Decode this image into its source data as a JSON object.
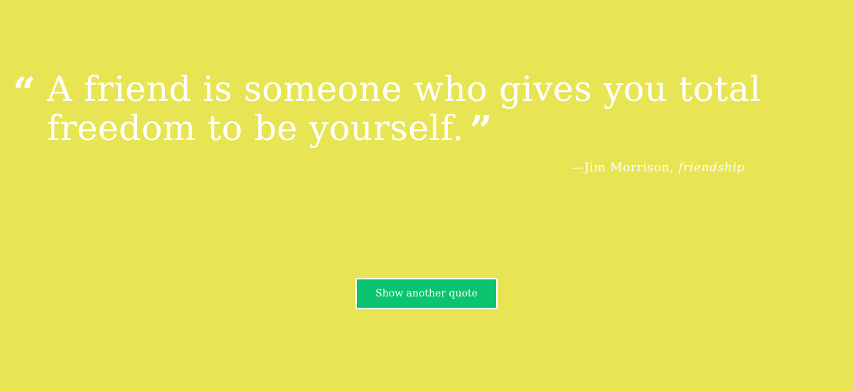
{
  "theme": {
    "background": "#e8e554",
    "text": "#ffffff",
    "button": "#0ac46e"
  },
  "quote": {
    "open_mark": "“",
    "text": "A friend is someone who gives you total freedom to be yourself.",
    "close_mark": "”",
    "author_prefix": "—Jim Morrison, ",
    "topic": "friendship"
  },
  "actions": {
    "new_quote_label": "Show another quote"
  }
}
